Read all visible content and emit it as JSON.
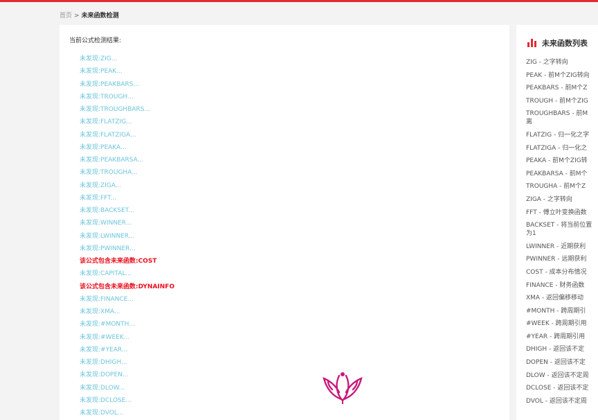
{
  "breadcrumb": {
    "home": "首页",
    "separator": ">",
    "current": "未来函数检测"
  },
  "result": {
    "title": "当前公式检测结果:",
    "items": [
      {
        "text": "未发现:ZIG...",
        "status": "ok"
      },
      {
        "text": "未发现:PEAK...",
        "status": "ok"
      },
      {
        "text": "未发现:PEAKBARS...",
        "status": "ok"
      },
      {
        "text": "未发现:TROUGH...",
        "status": "ok"
      },
      {
        "text": "未发现:TROUGHBARS...",
        "status": "ok"
      },
      {
        "text": "未发现:FLATZIG...",
        "status": "ok"
      },
      {
        "text": "未发现:FLATZIGA...",
        "status": "ok"
      },
      {
        "text": "未发现:PEAKA...",
        "status": "ok"
      },
      {
        "text": "未发现:PEAKBARSA...",
        "status": "ok"
      },
      {
        "text": "未发现:TROUGHA...",
        "status": "ok"
      },
      {
        "text": "未发现:ZIGA...",
        "status": "ok"
      },
      {
        "text": "未发现:FFT...",
        "status": "ok"
      },
      {
        "text": "未发现:BACKSET...",
        "status": "ok"
      },
      {
        "text": "未发现:WINNER...",
        "status": "ok"
      },
      {
        "text": "未发现:LWINNER...",
        "status": "ok"
      },
      {
        "text": "未发现:PWINNER...",
        "status": "ok"
      },
      {
        "text": "该公式包含未来函数:COST",
        "status": "hit"
      },
      {
        "text": "未发现:CAPITAL...",
        "status": "ok"
      },
      {
        "text": "该公式包含未来函数:DYNAINFO",
        "status": "hit"
      },
      {
        "text": "未发现:FINANCE...",
        "status": "ok"
      },
      {
        "text": "未发现:XMA...",
        "status": "ok"
      },
      {
        "text": "未发现:#MONTH...",
        "status": "ok"
      },
      {
        "text": "未发现:#WEEK...",
        "status": "ok"
      },
      {
        "text": "未发现:#YEAR...",
        "status": "ok"
      },
      {
        "text": "未发现:DHIGH...",
        "status": "ok"
      },
      {
        "text": "未发现:DOPEN...",
        "status": "ok"
      },
      {
        "text": "未发现:DLOW...",
        "status": "ok"
      },
      {
        "text": "未发现:DCLOSE...",
        "status": "ok"
      },
      {
        "text": "未发现:DVOL...",
        "status": "ok"
      }
    ]
  },
  "sidebar": {
    "icon": "bar-chart-icon",
    "title": "未来函数列表",
    "items": [
      "ZIG - 之字转向",
      "PEAK - 前M个ZIG转向",
      "PEAKBARS - 前M个Z",
      "TROUGH - 前M个ZIG",
      "TROUGHBARS - 前M",
      "离",
      "FLATZIG - 归一化之字",
      "FLATZIGA - 归一化之",
      "PEAKA - 前M个ZIG转",
      "PEAKBARSA - 前M个",
      "TROUGHA - 前M个Z",
      "ZIGA - 之字转向",
      "FFT - 傅立叶变换函数",
      "BACKSET - 将当前位置",
      "为1",
      "LWINNER - 近期获利",
      "PWINNER - 远期获利",
      "COST - 成本分布情况",
      "FINANCE - 财务函数",
      "XMA - 返回偏移移动",
      "#MONTH - 跨周期引",
      "#WEEK - 跨周期引用",
      "#YEAR - 跨周期引用",
      "DHIGH - 返回该不定",
      "DOPEN - 返回该不定",
      "DLOW - 返回该不定周",
      "DCLOSE - 返回该不定",
      "DVOL - 返回该不定周"
    ]
  },
  "colors": {
    "accent": "#e02b30",
    "ok": "#6cc4dc",
    "hit": "#e8101e",
    "logo": "#c8197a"
  },
  "watermark": {
    "icon": "lotus-logo-icon"
  }
}
